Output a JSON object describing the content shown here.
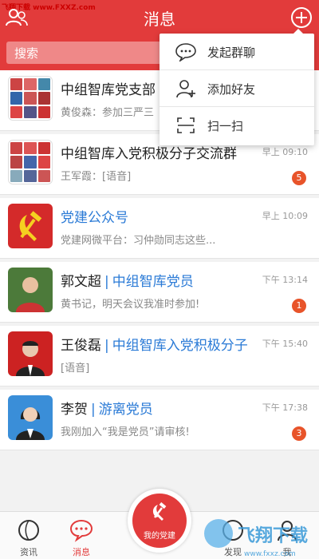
{
  "watermark": "飞翔下载 www.FXXZ.com",
  "header": {
    "title": "消息"
  },
  "search": {
    "placeholder": "搜索"
  },
  "dropdown": {
    "items": [
      {
        "label": "发起群聊",
        "icon": "chat-bubble-icon"
      },
      {
        "label": "添加好友",
        "icon": "add-user-icon"
      },
      {
        "label": "扫一扫",
        "icon": "scan-icon"
      }
    ]
  },
  "conversations": [
    {
      "name": "中组智库党支部",
      "message": "黄俊森：参加三严三",
      "time": "",
      "badge": ""
    },
    {
      "name": "中组智库入党积极分子交流群",
      "message": "王军霞：[语音]",
      "time": "早上 09:10",
      "badge": "5"
    },
    {
      "name": "党建公众号",
      "message": "党建网微平台：习仲勋同志这些...",
      "time": "早上 10:09",
      "badge": ""
    },
    {
      "name": "郭文超",
      "group": "中组智库党员",
      "message": "黄书记，明天会议我准时参加!",
      "time": "下午 13:14",
      "badge": "1"
    },
    {
      "name": "王俊磊",
      "group": "中组智库入党积极分子",
      "message": "[语音]",
      "time": "下午 15:40",
      "badge": ""
    },
    {
      "name": "李贺",
      "group": "游离党员",
      "message": "我刚加入“我是党员”请审核!",
      "time": "下午 17:38",
      "badge": "3"
    }
  ],
  "tabbar": {
    "tabs": [
      {
        "label": "资讯",
        "icon": "news-icon"
      },
      {
        "label": "消息",
        "icon": "message-icon"
      },
      {
        "label": "我的党建",
        "icon": "party-emblem-icon"
      },
      {
        "label": "发现",
        "icon": "discover-icon"
      },
      {
        "label": "我",
        "icon": "profile-icon"
      }
    ]
  },
  "bottom_watermark": "飞翔下载 www.fxxz.com",
  "colors": {
    "brand": "#e23b3b",
    "link": "#2a7ad6",
    "badge": "#e8542a"
  }
}
